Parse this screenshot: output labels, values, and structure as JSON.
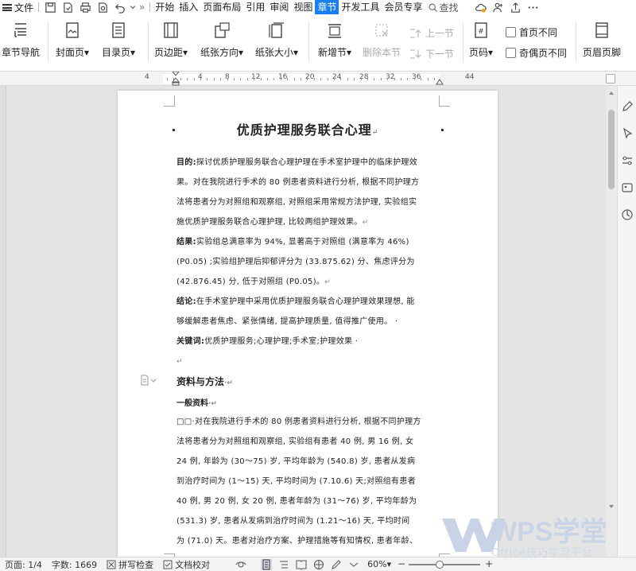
{
  "menubar": {
    "file_label": "文件",
    "tabs": [
      "开始",
      "插入",
      "页面布局",
      "引用",
      "审阅",
      "视图",
      "章节",
      "开发工具",
      "会员专享"
    ],
    "active_tab": "章节",
    "search_label": "查找",
    "more_symbol": "»"
  },
  "ribbon": {
    "section_nav": "章节导航",
    "cover_page": "封面页",
    "toc_page": "目录页",
    "margins": "页边距",
    "orientation": "纸张方向",
    "paper_size": "纸张大小",
    "new_section": "新增节",
    "delete_section": "删除本节",
    "prev_section": "上一节",
    "next_section": "下一节",
    "page_number": "页码",
    "first_page_different": "首页不同",
    "odd_even_different": "奇偶页不同",
    "header_footer": "页眉页脚"
  },
  "ruler": {
    "numbers": [
      "4",
      "4",
      "8",
      "12",
      "16",
      "20",
      "24",
      "28",
      "32",
      "36",
      "44"
    ]
  },
  "document": {
    "title": "优质护理服务联合心理",
    "p1_label": "目的:",
    "p1_lines": [
      "探讨优质护理服务联合心理护理在手术室护理中的临床护理效",
      "果。对在我院进行手术的 80 例患者资料进行分析, 根据不同护理方",
      "法将患者分为对照组和观察组, 对照组采用常规方法护理, 实验组实",
      "施优质护理服务联合心理护理, 比较两组护理效果。"
    ],
    "p2_label": "结果:",
    "p2_lines": [
      "实验组总满意率为 94%, 显著高于对照组 (满意率为 46%)",
      "(P0.05) ;实验组护理后抑郁评分为 (33.875.62) 分、焦虑评分为",
      "(42.876.45) 分, 低于对照组 (P0.05)。"
    ],
    "p3_label": "结论:",
    "p3_lines": [
      "在手术室护理中采用优质护理服务联合心理护理效果理想, 能",
      "够缓解患者焦虑、紧张情绪, 提高护理质量, 值得推广使用。 ·"
    ],
    "p4_label": "关键词:",
    "p4_text": "优质护理服务;心理护理;手术室;护理效果 ·",
    "section_heading": "资料与方法",
    "sub_heading": "一般资料",
    "p5_lines": [
      "□□·对在我院进行手术的 80 例患者资料进行分析, 根据不同护理方",
      "法将患者分为对照组和观察组, 实验组有患者 40 例, 男 16 例, 女",
      "24 例, 年龄为 (30～75) 岁, 平均年龄为 (540.8) 岁, 患者从发病",
      "到治疗时间为 (1～15) 天, 平均时间为 (7.10.6) 天;对照组有患者",
      "40 例, 男 20 例, 女 20 例, 患者年龄为 (31～76) 岁, 平均年龄为",
      "(531.3) 岁, 患者从发病到治疗时间为 (1.21～16) 天, 平均时间",
      "为 (71.0) 天。患者对治疗方案、护理措施等有知情权, 患者年龄、"
    ]
  },
  "watermark": {
    "brand": "WPS学堂",
    "tagline": "Office技巧学习平台"
  },
  "statusbar": {
    "page": "页面: 1/4",
    "word_count": "字数: 1669",
    "spell_check": "拼写检查",
    "doc_proof": "文档校对",
    "zoom": "60%"
  },
  "colors": {
    "accent": "#1a7ff0",
    "watermark": "#c9d3e6"
  }
}
